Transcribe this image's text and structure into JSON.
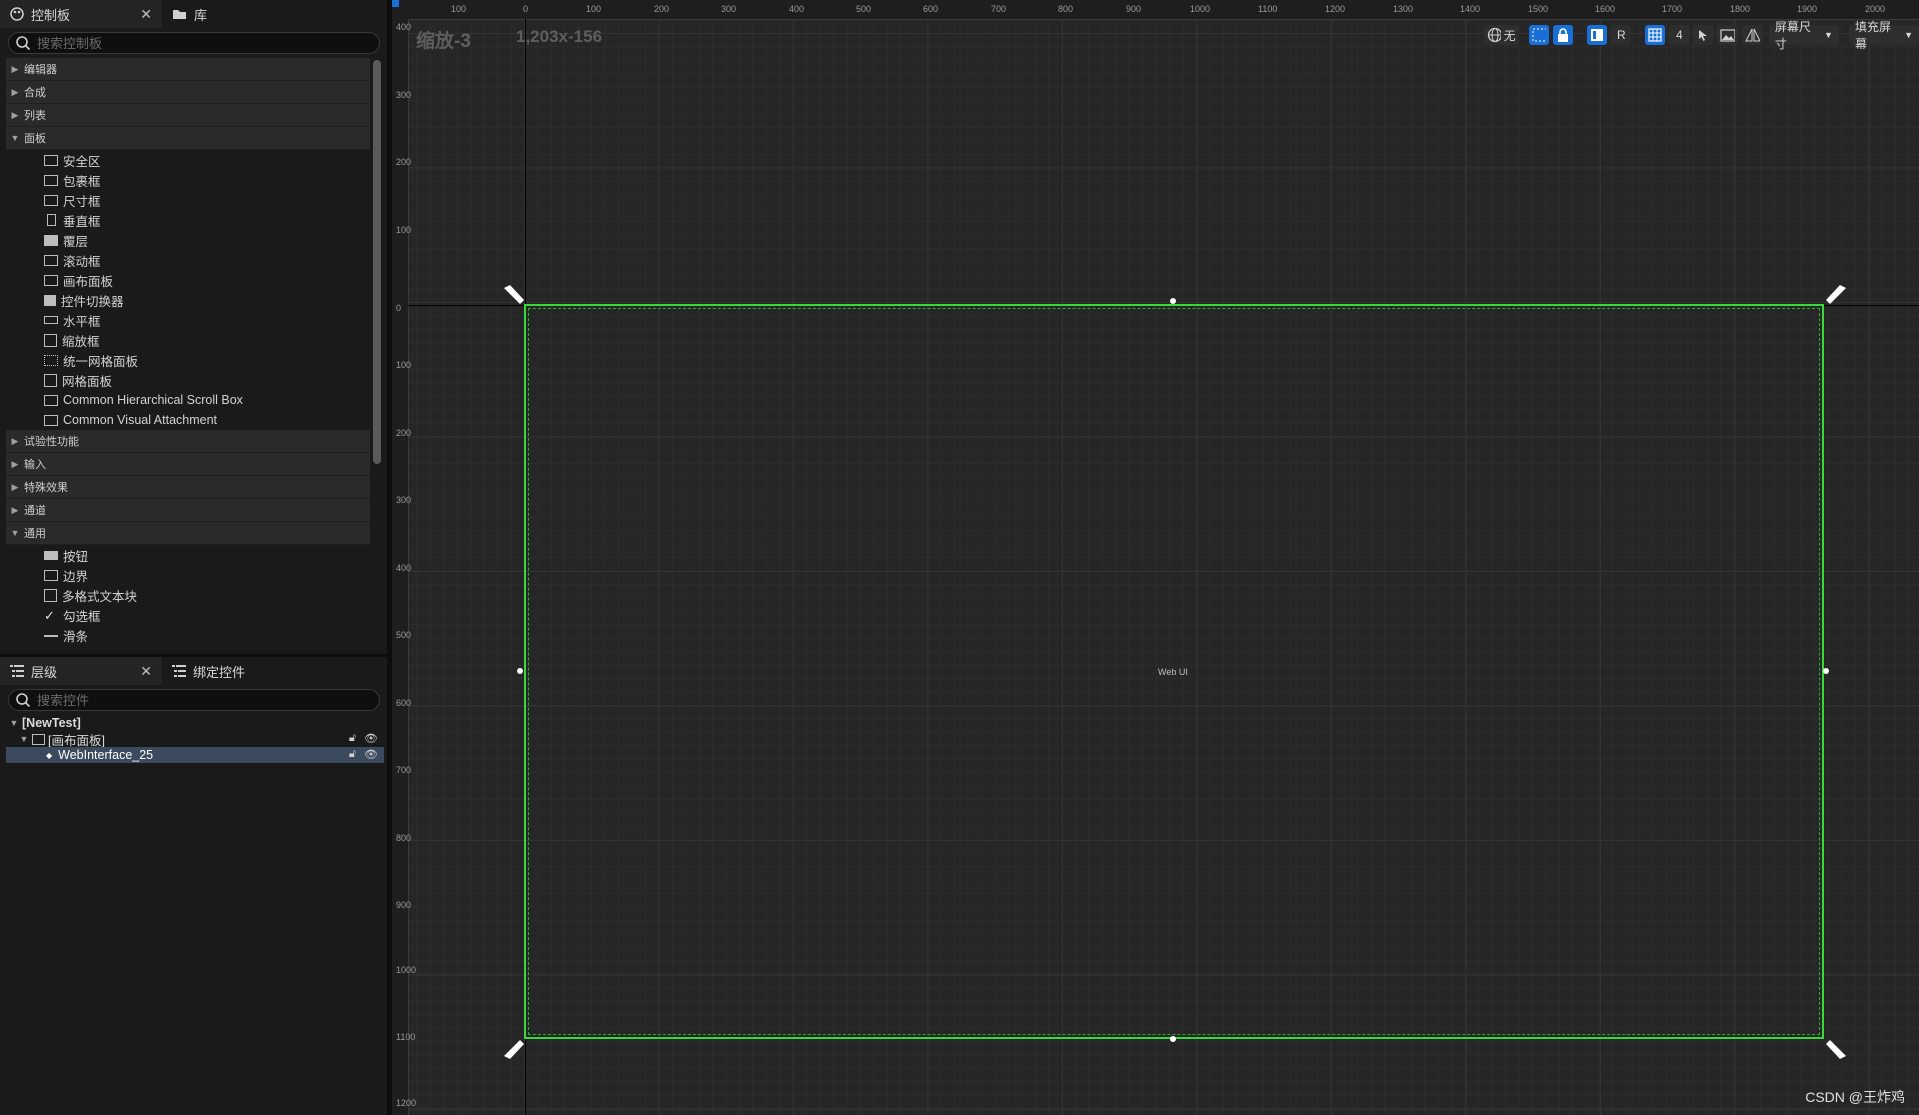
{
  "palette_tabs": [
    {
      "label": "控制板",
      "icon": "palette-icon"
    },
    {
      "label": "库",
      "icon": "folder-icon"
    }
  ],
  "palette_search_placeholder": "搜索控制板",
  "categories_before": [
    {
      "label": "编辑器",
      "expanded": false
    },
    {
      "label": "合成",
      "expanded": false
    },
    {
      "label": "列表",
      "expanded": false
    },
    {
      "label": "面板",
      "expanded": true
    }
  ],
  "panel_items": [
    {
      "label": "安全区",
      "icon": "safe-zone-icon"
    },
    {
      "label": "包裹框",
      "icon": "wrap-box-icon"
    },
    {
      "label": "尺寸框",
      "icon": "size-box-icon"
    },
    {
      "label": "垂直框",
      "icon": "vertical-box-icon"
    },
    {
      "label": "覆层",
      "icon": "overlay-icon"
    },
    {
      "label": "滚动框",
      "icon": "scroll-box-icon"
    },
    {
      "label": "画布面板",
      "icon": "canvas-panel-icon"
    },
    {
      "label": "控件切换器",
      "icon": "widget-switcher-icon"
    },
    {
      "label": "水平框",
      "icon": "horizontal-box-icon"
    },
    {
      "label": "缩放框",
      "icon": "scale-box-icon"
    },
    {
      "label": "统一网格面板",
      "icon": "uniform-grid-icon"
    },
    {
      "label": "网格面板",
      "icon": "grid-panel-icon"
    },
    {
      "label": "Common Hierarchical Scroll Box",
      "icon": "scroll-box-icon"
    },
    {
      "label": "Common Visual Attachment",
      "icon": "attachment-icon"
    }
  ],
  "categories_after": [
    {
      "label": "试验性功能",
      "expanded": false
    },
    {
      "label": "输入",
      "expanded": false
    },
    {
      "label": "特殊效果",
      "expanded": false
    },
    {
      "label": "通道",
      "expanded": false
    },
    {
      "label": "通用",
      "expanded": true
    }
  ],
  "common_items": [
    {
      "label": "按钮",
      "icon": "button-icon"
    },
    {
      "label": "边界",
      "icon": "border-icon"
    },
    {
      "label": "多格式文本块",
      "icon": "rich-text-icon"
    },
    {
      "label": "勾选框",
      "icon": "checkbox-icon"
    },
    {
      "label": "滑条",
      "icon": "slider-icon"
    }
  ],
  "hierarchy_tabs": [
    {
      "label": "层级",
      "icon": "hierarchy-icon"
    },
    {
      "label": "绑定控件",
      "icon": "bind-widget-icon"
    }
  ],
  "hierarchy_search_placeholder": "搜索控件",
  "tree": {
    "root": "[NewTest]",
    "canvas": "[画布面板]",
    "selected": "WebInterface_25"
  },
  "overlay": {
    "zoom": "缩放-3",
    "size": "1,203x-156"
  },
  "toolbar": {
    "world_label": "无",
    "r_label": "R",
    "grid_value": "4",
    "screen_size": "屏幕尺寸",
    "fill_screen": "填充屏幕"
  },
  "ruler_top_labels": [
    "100",
    "0",
    "100",
    "200",
    "300",
    "400",
    "500",
    "600",
    "700",
    "800",
    "900",
    "1000",
    "1100",
    "1200",
    "1300",
    "1400",
    "1500",
    "1600",
    "1700",
    "1800",
    "1900",
    "2000"
  ],
  "ruler_left_labels": [
    "400",
    "300",
    "200",
    "100",
    "0",
    "100",
    "200",
    "300",
    "400",
    "500",
    "600",
    "700",
    "800",
    "900",
    "1000",
    "1100",
    "1200"
  ],
  "widget_label": "Web UI",
  "watermark": "CSDN @王炸鸡",
  "colors": {
    "selection_outline": "#36d83a",
    "accent": "#1a6fd6"
  }
}
